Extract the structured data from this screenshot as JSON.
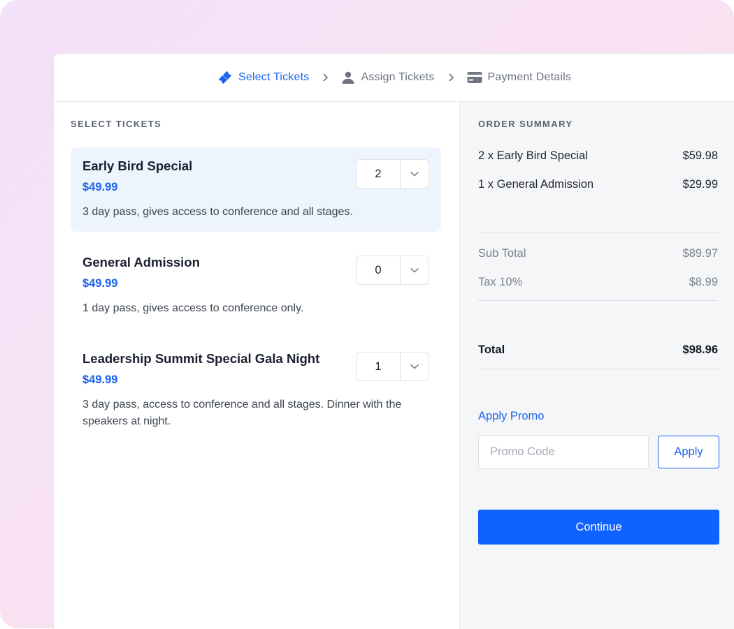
{
  "stepper": {
    "steps": [
      {
        "label": "Select Tickets",
        "icon": "ticket-icon",
        "active": true
      },
      {
        "label": "Assign Tickets",
        "icon": "person-icon",
        "active": false
      },
      {
        "label": "Payment Details",
        "icon": "credit-card-icon",
        "active": false
      }
    ],
    "separator_icon": "chevron-right-icon"
  },
  "tickets_section": {
    "title": "SELECT TICKETS",
    "tickets": [
      {
        "name": "Early Bird Special",
        "price": "$49.99",
        "description": "3 day pass, gives access to conference and all stages.",
        "quantity": "2",
        "selected": true
      },
      {
        "name": "General Admission",
        "price": "$49.99",
        "description": "1 day pass, gives access to conference only.",
        "quantity": "0",
        "selected": false
      },
      {
        "name": "Leadership Summit Special Gala Night",
        "price": "$49.99",
        "description": "3 day pass, access to conference and all stages. Dinner with the speakers at night.",
        "quantity": "1",
        "selected": false
      }
    ]
  },
  "summary": {
    "title": "ORDER SUMMARY",
    "items": [
      {
        "label": "2 x Early Bird Special",
        "amount": "$59.98"
      },
      {
        "label": "1 x General Admission",
        "amount": "$29.99"
      }
    ],
    "subtotal_label": "Sub Total",
    "subtotal": "$89.97",
    "tax_label": "Tax 10%",
    "tax": "$8.99",
    "total_label": "Total",
    "total": "$98.96",
    "promo_link": "Apply Promo",
    "promo_placeholder": "Promo Code",
    "promo_value": "",
    "apply_label": "Apply",
    "continue_label": "Continue"
  },
  "colors": {
    "accent": "#1863f5",
    "button": "#0f62fe",
    "selected_bg": "#eef4fd",
    "summary_bg": "#f5f6f8"
  }
}
